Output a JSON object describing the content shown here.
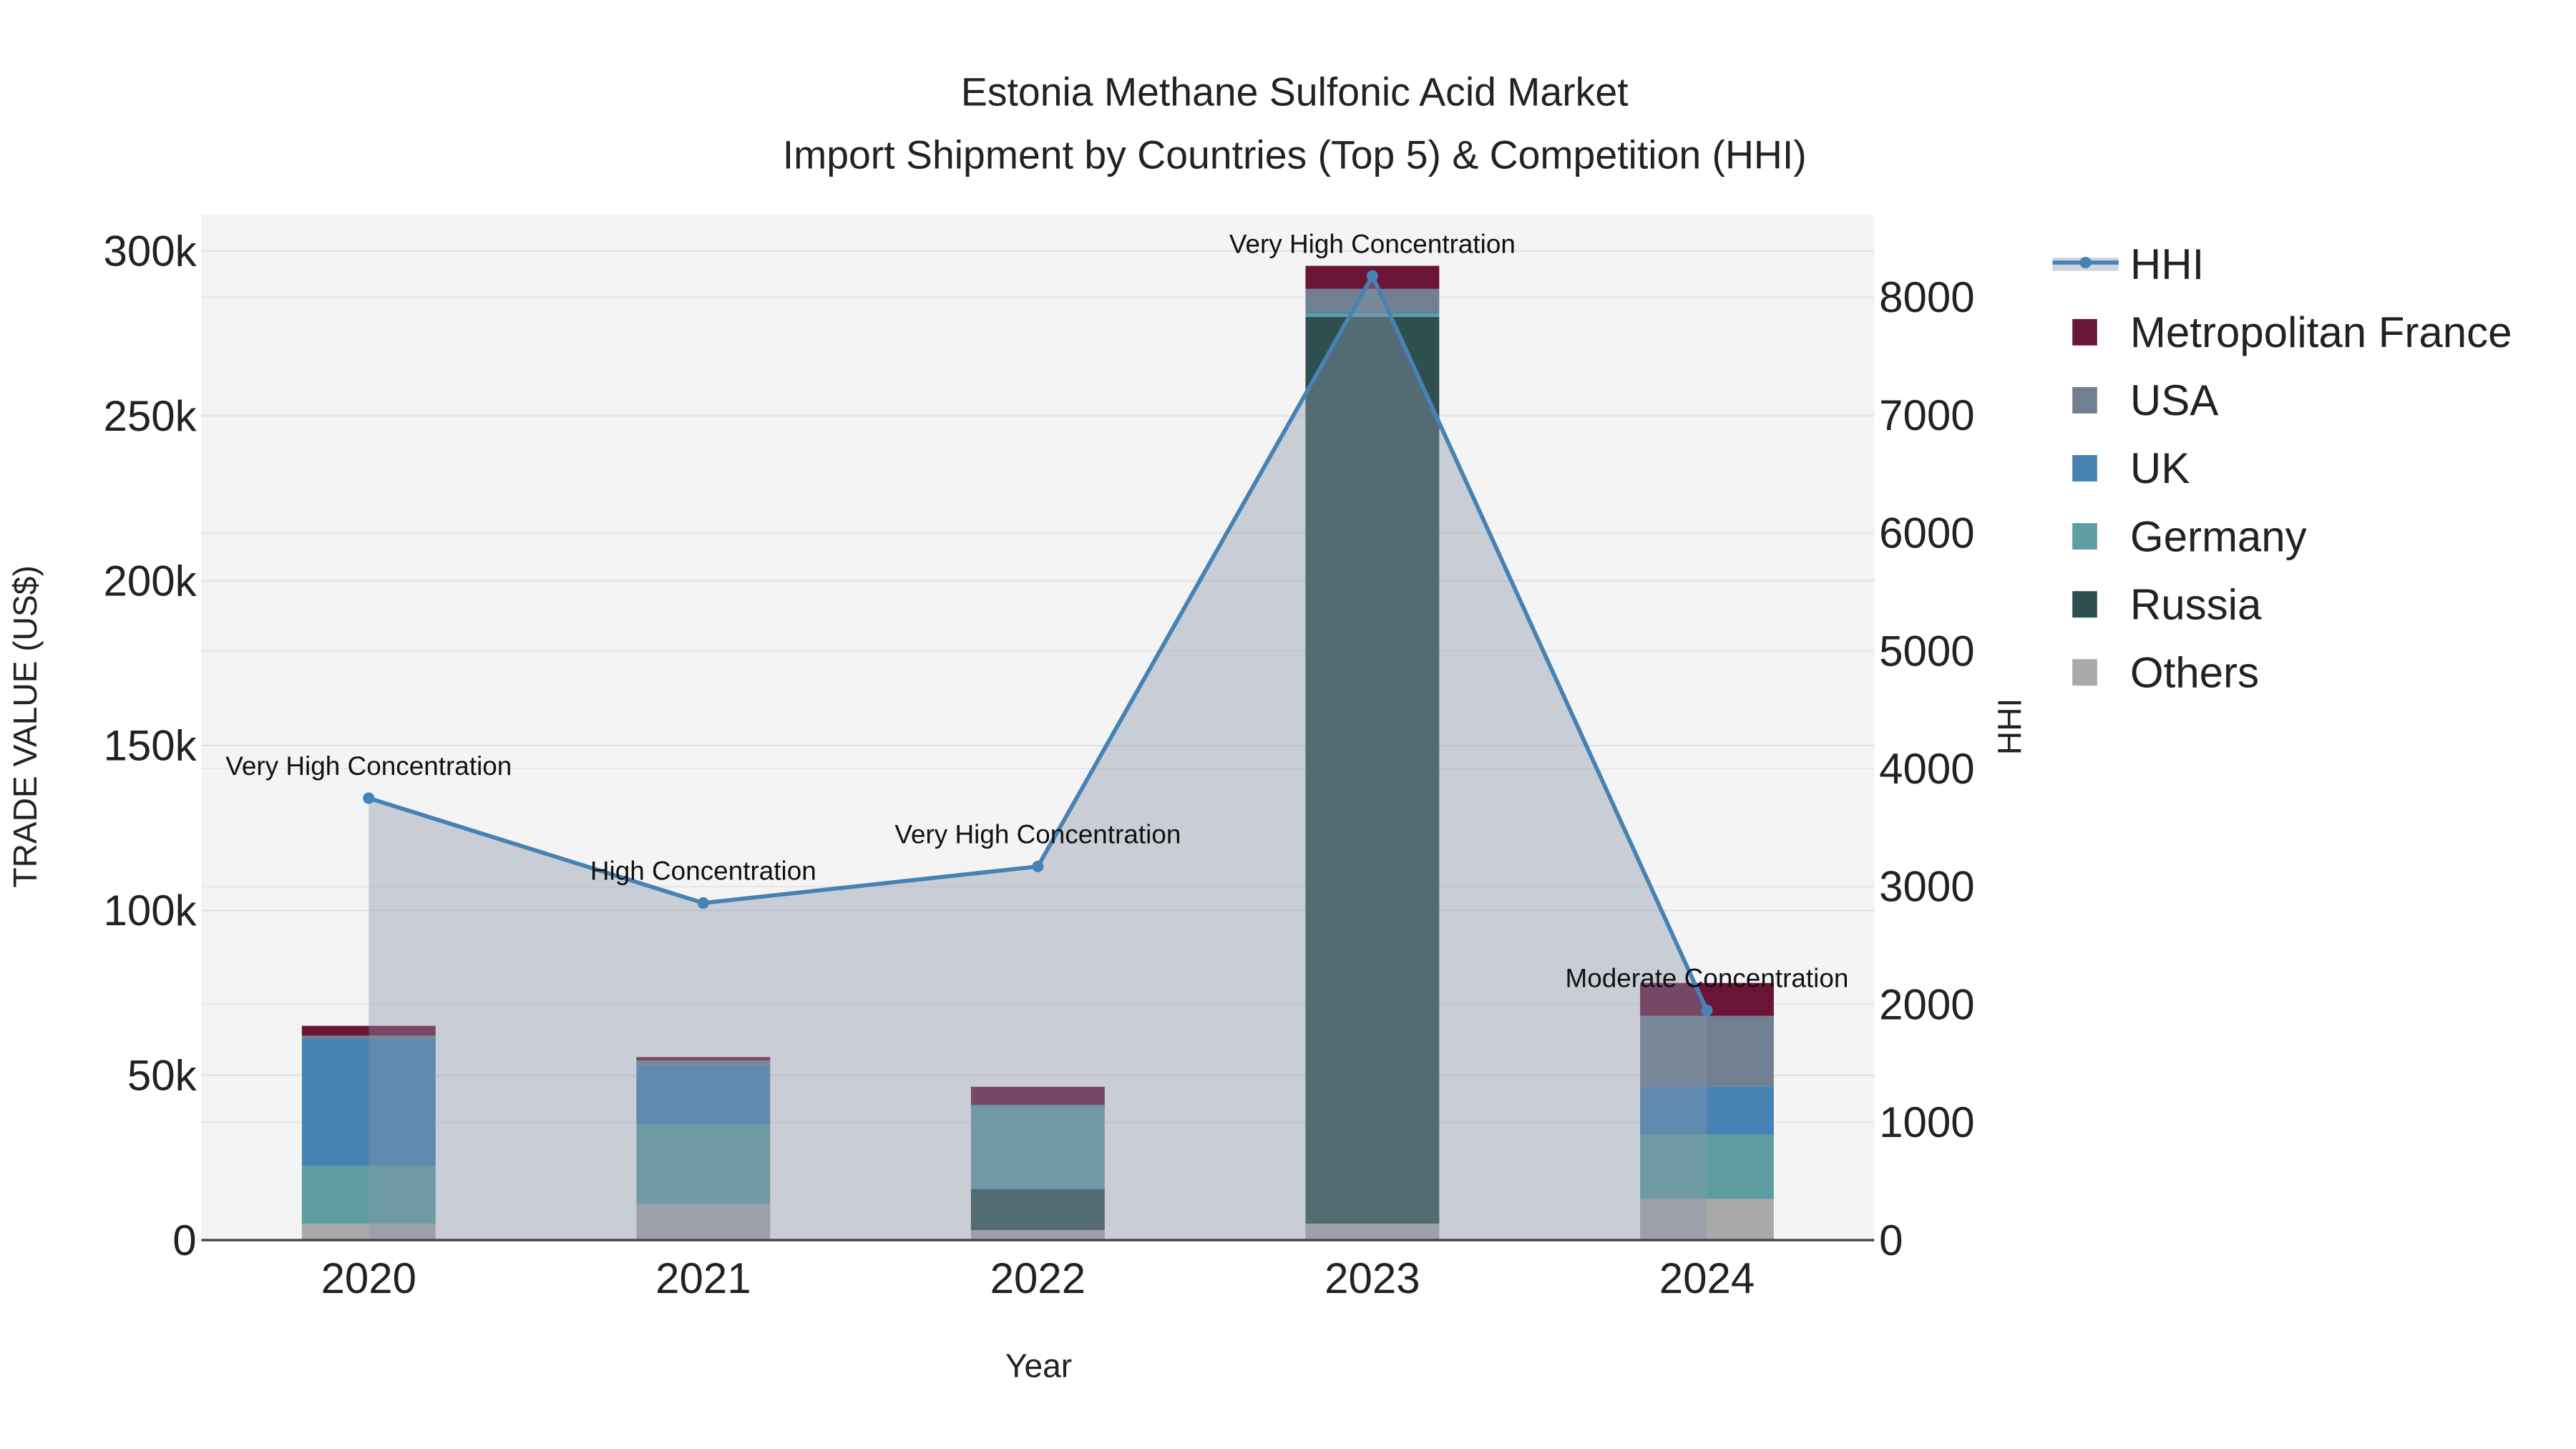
{
  "chart_data": {
    "type": "bar",
    "stacked": true,
    "title": "Estonia Methane Sulfonic Acid Market",
    "subtitle": "Import Shipment by Countries (Top 5) & Competition (HHI)",
    "xlabel": "Year",
    "ylabel": "TRADE VALUE (US$)",
    "y2label": "HHI",
    "categories": [
      "2020",
      "2021",
      "2022",
      "2023",
      "2024"
    ],
    "ylim": [
      0,
      310000
    ],
    "y2lim": [
      0,
      8700
    ],
    "yticks": [
      0,
      50000,
      100000,
      150000,
      200000,
      250000,
      300000
    ],
    "ytick_labels": [
      "0",
      "50k",
      "100k",
      "150k",
      "200k",
      "250k",
      "300k"
    ],
    "y2ticks": [
      0,
      1000,
      2000,
      3000,
      4000,
      5000,
      6000,
      7000,
      8000
    ],
    "y2tick_labels": [
      "0",
      "1000",
      "2000",
      "3000",
      "4000",
      "5000",
      "6000",
      "7000",
      "8000"
    ],
    "series": [
      {
        "name": "Others",
        "color": "#a9a9a9",
        "values": [
          5000,
          11000,
          3000,
          5000,
          12500
        ]
      },
      {
        "name": "Russia",
        "color": "#2f4f4f",
        "values": [
          0,
          0,
          12500,
          275000,
          0
        ]
      },
      {
        "name": "Germany",
        "color": "#5f9ea0",
        "values": [
          17500,
          24000,
          25000,
          1000,
          19500
        ]
      },
      {
        "name": "UK",
        "color": "#4682b4",
        "values": [
          38500,
          18000,
          500,
          500,
          14500
        ]
      },
      {
        "name": "USA",
        "color": "#708090",
        "values": [
          1000,
          1500,
          0,
          7000,
          21500
        ]
      },
      {
        "name": "Metropolitan France",
        "color": "#6a1538",
        "values": [
          3000,
          1000,
          5500,
          7000,
          10000
        ]
      }
    ],
    "hhi": {
      "name": "HHI",
      "color": "#4682b4",
      "values": [
        3750,
        2860,
        3170,
        8180,
        1950
      ],
      "annotations": [
        "Very High Concentration",
        "High Concentration",
        "Very High Concentration",
        "Very High Concentration",
        "Moderate Concentration"
      ]
    },
    "legend_order": [
      "HHI",
      "Metropolitan France",
      "USA",
      "UK",
      "Germany",
      "Russia",
      "Others"
    ],
    "legend_position": "right",
    "grid": true
  }
}
